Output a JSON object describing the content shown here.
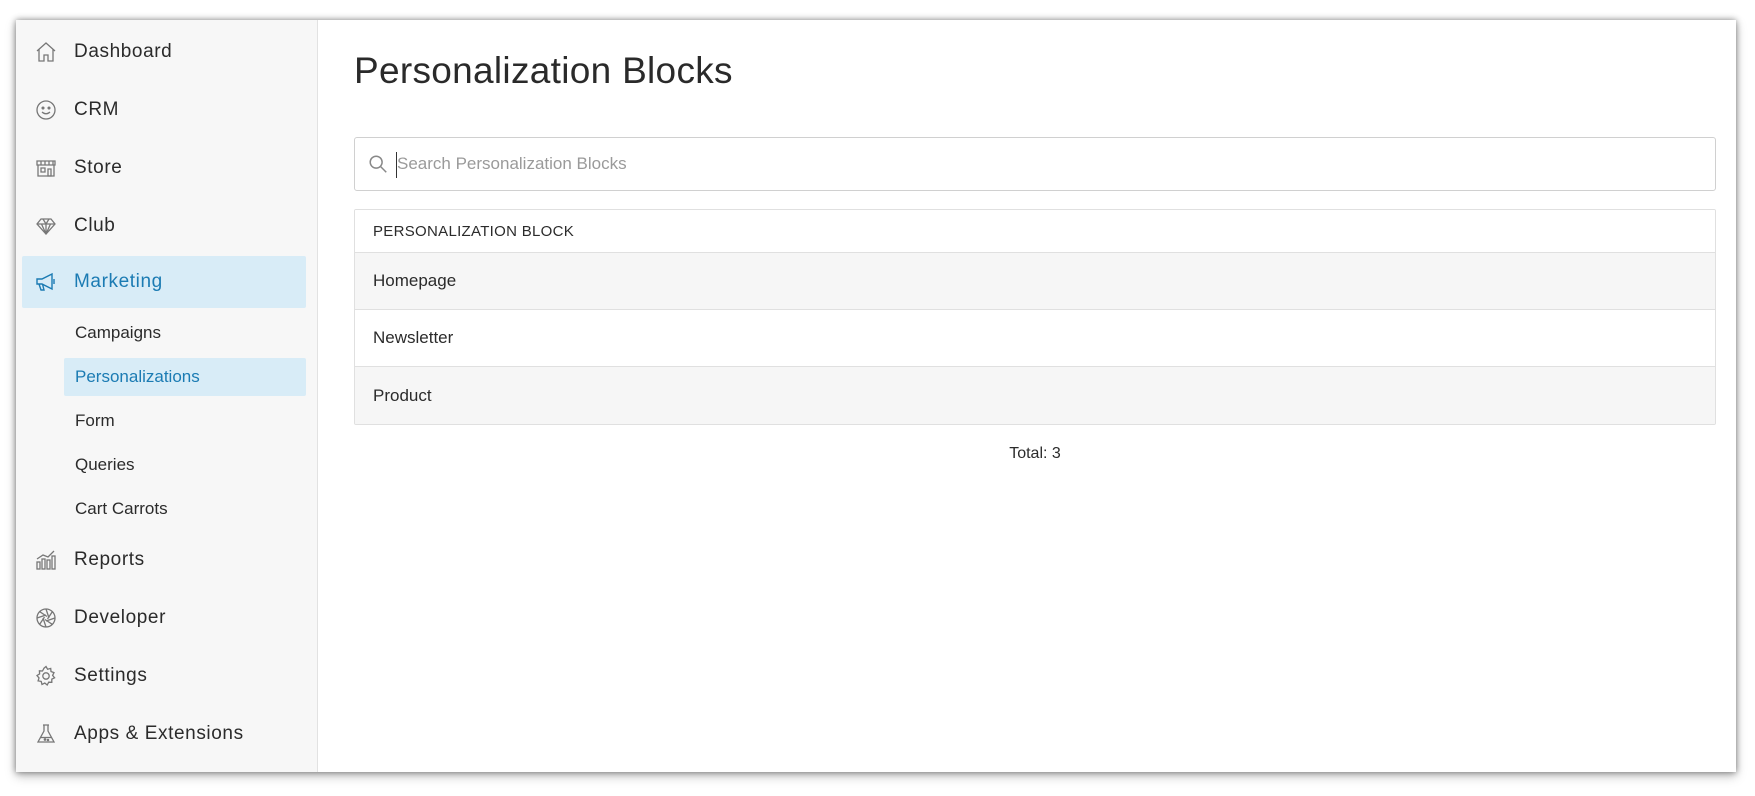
{
  "sidebar": {
    "items": [
      {
        "label": "Dashboard",
        "icon": "home-icon"
      },
      {
        "label": "CRM",
        "icon": "smiley-icon"
      },
      {
        "label": "Store",
        "icon": "storefront-icon"
      },
      {
        "label": "Club",
        "icon": "diamond-icon"
      },
      {
        "label": "Marketing",
        "icon": "megaphone-icon",
        "active": true
      },
      {
        "label": "Reports",
        "icon": "bar-chart-icon"
      },
      {
        "label": "Developer",
        "icon": "aperture-icon"
      },
      {
        "label": "Settings",
        "icon": "gear-icon"
      },
      {
        "label": "Apps & Extensions",
        "icon": "flask-icon"
      }
    ],
    "marketing_sub": [
      {
        "label": "Campaigns"
      },
      {
        "label": "Personalizations",
        "active": true
      },
      {
        "label": "Form"
      },
      {
        "label": "Queries"
      },
      {
        "label": "Cart Carrots"
      }
    ]
  },
  "main": {
    "title": "Personalization Blocks",
    "search": {
      "placeholder": "Search Personalization Blocks",
      "value": ""
    },
    "table": {
      "header": "PERSONALIZATION BLOCK",
      "rows": [
        "Homepage",
        "Newsletter",
        "Product"
      ]
    },
    "total": "Total: 3"
  },
  "colors": {
    "accent": "#1b7bb3",
    "active_bg": "#d8ecf7",
    "sidebar_bg": "#f7f7f7"
  }
}
